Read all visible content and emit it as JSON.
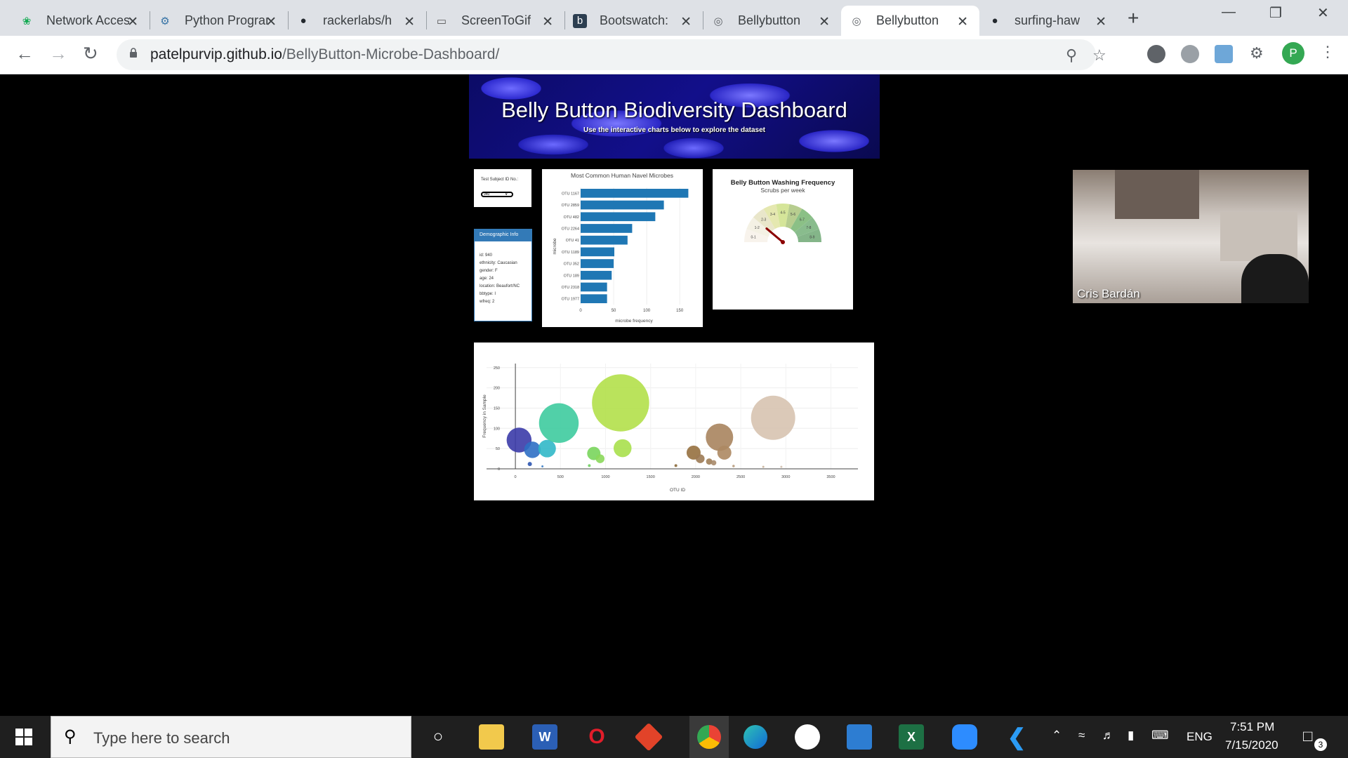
{
  "browser": {
    "tabs": [
      {
        "title": "Network Access",
        "icon": "mongodb-leaf-icon",
        "active": false
      },
      {
        "title": "Python Programming",
        "icon": "python-icon",
        "active": false
      },
      {
        "title": "rackerlabs/h",
        "icon": "github-icon",
        "active": false
      },
      {
        "title": "ScreenToGif",
        "icon": "monitor-icon",
        "active": false
      },
      {
        "title": "Bootswatch:",
        "icon": "bootswatch-icon",
        "active": false
      },
      {
        "title": "Bellybutton",
        "icon": "globe-icon",
        "active": false
      },
      {
        "title": "Bellybutton",
        "icon": "globe-icon",
        "active": true
      },
      {
        "title": "surfing-haw",
        "icon": "github-icon",
        "active": false
      }
    ],
    "url_host": "patelpurvip.github.io",
    "url_path": "/BellyButton-Microbe-Dashboard/",
    "profile_initial": "P"
  },
  "dashboard": {
    "title": "Belly Button Biodiversity Dashboard",
    "subtitle": "Use the interactive charts below to explore the dataset",
    "selector_label": "Test Subject ID No.:",
    "selector_value": "940",
    "demo_title": "Demographic Info",
    "demo_items": [
      "id: 940",
      "ethnicity: Caucasian",
      "gender: F",
      "age: 24",
      "location: Beaufort/NC",
      "bbtype: I",
      "wfreq: 2"
    ]
  },
  "chart_data": [
    {
      "type": "bar",
      "orientation": "horizontal",
      "title": "Most Common Human Navel Microbes",
      "xlabel": "microbe frequency",
      "ylabel": "microbe",
      "categories": [
        "OTU 1167",
        "OTU 2859",
        "OTU 482",
        "OTU 2264",
        "OTU 41",
        "OTU 1189",
        "OTU 352",
        "OTU 189",
        "OTU 2318",
        "OTU 1977"
      ],
      "values": [
        163,
        126,
        113,
        78,
        71,
        51,
        50,
        47,
        40,
        40
      ],
      "xlim": [
        0,
        170
      ],
      "xticks": [
        0,
        50,
        100,
        150
      ],
      "color": "#1f77b4"
    },
    {
      "type": "gauge",
      "title": "Belly Button Washing Frequency",
      "subtitle": "Scrubs per week",
      "sectors": [
        "0-1",
        "1-2",
        "2-3",
        "3-4",
        "4-5",
        "5-6",
        "6-7",
        "7-8",
        "8-9"
      ],
      "range": [
        0,
        9
      ],
      "value": 2
    },
    {
      "type": "scatter",
      "mode": "bubble",
      "xlabel": "OTU ID",
      "ylabel": "Frequency in Sample",
      "xlim": [
        -320,
        3800
      ],
      "ylim": [
        0,
        260
      ],
      "xticks": [
        0,
        500,
        1000,
        1500,
        2000,
        2500,
        3000,
        3500
      ],
      "yticks": [
        0,
        50,
        100,
        150,
        200,
        250
      ],
      "points": [
        {
          "x": 41,
          "y": 71,
          "c": "#3b3ba8"
        },
        {
          "x": 189,
          "y": 47,
          "c": "#2f6fc4"
        },
        {
          "x": 352,
          "y": 50,
          "c": "#31b8c8"
        },
        {
          "x": 482,
          "y": 113,
          "c": "#3ecb9e"
        },
        {
          "x": 1167,
          "y": 163,
          "c": "#b2e04a"
        },
        {
          "x": 1189,
          "y": 51,
          "c": "#a8e04c"
        },
        {
          "x": 870,
          "y": 38,
          "c": "#79d55c"
        },
        {
          "x": 940,
          "y": 25,
          "c": "#8bd85a"
        },
        {
          "x": 2264,
          "y": 78,
          "c": "#a8845e"
        },
        {
          "x": 2318,
          "y": 40,
          "c": "#ad8862"
        },
        {
          "x": 1977,
          "y": 40,
          "c": "#96703f"
        },
        {
          "x": 2859,
          "y": 126,
          "c": "#d7c3b0"
        },
        {
          "x": 2050,
          "y": 25,
          "c": "#9c7a54"
        },
        {
          "x": 2150,
          "y": 18,
          "c": "#a07e58"
        },
        {
          "x": 2200,
          "y": 15,
          "c": "#a88b6b"
        },
        {
          "x": 160,
          "y": 12,
          "c": "#2c55b0"
        },
        {
          "x": 300,
          "y": 6,
          "c": "#3d80c8"
        },
        {
          "x": 820,
          "y": 8,
          "c": "#70cf62"
        },
        {
          "x": 1780,
          "y": 8,
          "c": "#8c6a3a"
        },
        {
          "x": 2420,
          "y": 7,
          "c": "#b89b7c"
        },
        {
          "x": 2750,
          "y": 5,
          "c": "#c9b39b"
        },
        {
          "x": 2950,
          "y": 5,
          "c": "#d0bfae"
        }
      ]
    }
  ],
  "video": {
    "participant": "Cris Bardán"
  },
  "taskbar": {
    "search_placeholder": "Type here to search",
    "language": "ENG",
    "time": "7:51 PM",
    "date": "7/15/2020",
    "notifications": "3"
  }
}
